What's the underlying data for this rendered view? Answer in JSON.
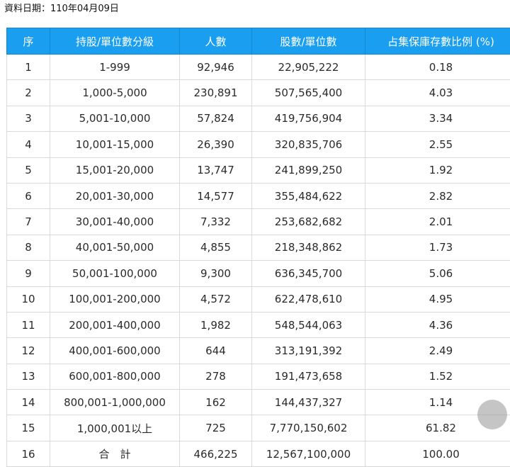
{
  "page": {
    "date_label": "資料日期：110年04月09日"
  },
  "table": {
    "headers": [
      "序",
      "持股/單位數分級",
      "人數",
      "股數/單位數",
      "占集保庫存數比例 (%)"
    ],
    "rows": [
      [
        "1",
        "1-999",
        "92,946",
        "22,905,222",
        "0.18"
      ],
      [
        "2",
        "1,000-5,000",
        "230,891",
        "507,565,400",
        "4.03"
      ],
      [
        "3",
        "5,001-10,000",
        "57,824",
        "419,756,904",
        "3.34"
      ],
      [
        "4",
        "10,001-15,000",
        "26,390",
        "320,835,706",
        "2.55"
      ],
      [
        "5",
        "15,001-20,000",
        "13,747",
        "241,899,250",
        "1.92"
      ],
      [
        "6",
        "20,001-30,000",
        "14,577",
        "355,484,622",
        "2.82"
      ],
      [
        "7",
        "30,001-40,000",
        "7,332",
        "253,682,682",
        "2.01"
      ],
      [
        "8",
        "40,001-50,000",
        "4,855",
        "218,348,862",
        "1.73"
      ],
      [
        "9",
        "50,001-100,000",
        "9,300",
        "636,345,700",
        "5.06"
      ],
      [
        "10",
        "100,001-200,000",
        "4,572",
        "622,478,610",
        "4.95"
      ],
      [
        "11",
        "200,001-400,000",
        "1,982",
        "548,544,063",
        "4.36"
      ],
      [
        "12",
        "400,001-600,000",
        "644",
        "313,191,392",
        "2.49"
      ],
      [
        "13",
        "600,001-800,000",
        "278",
        "191,473,658",
        "1.52"
      ],
      [
        "14",
        "800,001-1,000,000",
        "162",
        "144,437,327",
        "1.14"
      ],
      [
        "15",
        "1,000,001以上",
        "725",
        "7,770,150,602",
        "61.82"
      ],
      [
        "16",
        "合　計",
        "466,225",
        "12,567,100,000",
        "100.00"
      ]
    ]
  },
  "colors": {
    "header_bg": "#1a9ff0",
    "header_text": "#ffffff",
    "grid": "#d9d9d9"
  }
}
